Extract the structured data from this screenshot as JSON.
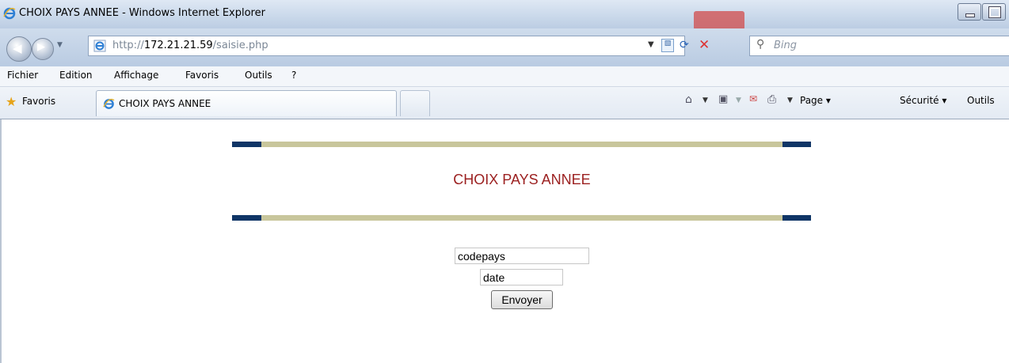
{
  "window": {
    "title": "CHOIX PAYS ANNEE - Windows Internet Explorer"
  },
  "address": {
    "url_prefix": "http://",
    "url_host": "172.21.21.59",
    "url_path": "/saisie.php"
  },
  "search": {
    "placeholder": "Bing"
  },
  "menu": {
    "items": [
      "Fichier",
      "Edition",
      "Affichage",
      "Favoris",
      "Outils",
      "?"
    ]
  },
  "favorites": {
    "label": "Favoris"
  },
  "tab": {
    "label": "CHOIX PAYS ANNEE"
  },
  "commandbar": {
    "page": "Page",
    "security": "Sécurité",
    "tools": "Outils"
  },
  "page": {
    "heading": "CHOIX PAYS ANNEE",
    "codepays_value": "codepays",
    "date_value": "date",
    "submit_label": "Envoyer"
  },
  "colors": {
    "heading": "#9b1f1f",
    "bar": "#c8c69c",
    "bar_end": "#0f3566"
  },
  "icons": [
    "ie-icon",
    "back-icon",
    "forward-icon",
    "page-icon",
    "refresh-icon",
    "stop-icon",
    "search-icon",
    "star-icon",
    "home-icon",
    "feeds-icon",
    "mail-icon",
    "print-icon"
  ]
}
